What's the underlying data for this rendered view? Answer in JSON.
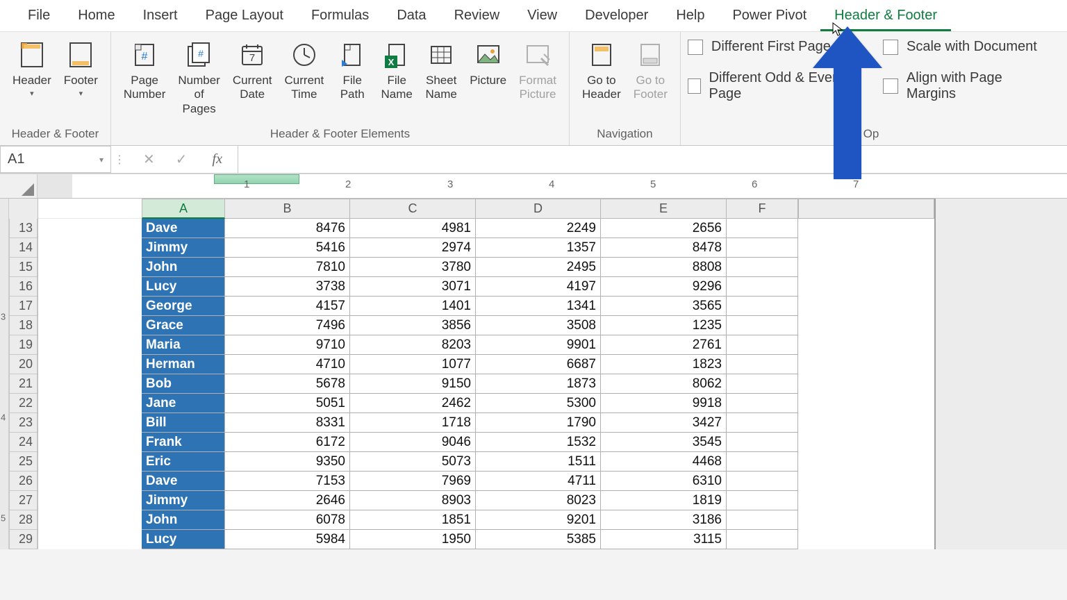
{
  "tabs": [
    "File",
    "Home",
    "Insert",
    "Page Layout",
    "Formulas",
    "Data",
    "Review",
    "View",
    "Developer",
    "Help",
    "Power Pivot",
    "Header & Footer"
  ],
  "activeTab": 11,
  "groups": {
    "hf": {
      "label": "Header & Footer",
      "header": "Header",
      "footer": "Footer"
    },
    "elements": {
      "label": "Header & Footer Elements",
      "items": [
        "Page\nNumber",
        "Number\nof Pages",
        "Current\nDate",
        "Current\nTime",
        "File\nPath",
        "File\nName",
        "Sheet\nName",
        "Picture",
        "Format\nPicture"
      ]
    },
    "nav": {
      "label": "Navigation",
      "goHeader": "Go to\nHeader",
      "goFooter": "Go to\nFooter"
    },
    "options": {
      "label": "Op",
      "firstPage": "Different First Page",
      "oddEven": "Different Odd & Even Page",
      "scale": "Scale with Document",
      "align": "Align with Page Margins"
    }
  },
  "nameBox": "A1",
  "fx": "fx",
  "rulerNums": [
    "1",
    "2",
    "3",
    "4",
    "5",
    "6",
    "7"
  ],
  "colHeaders": [
    "A",
    "B",
    "C",
    "D",
    "E",
    "F"
  ],
  "vNums": [
    "3",
    "4",
    "5"
  ],
  "rows": [
    {
      "n": "13",
      "name": "Dave",
      "v": [
        "8476",
        "4981",
        "2249",
        "2656"
      ]
    },
    {
      "n": "14",
      "name": "Jimmy",
      "v": [
        "5416",
        "2974",
        "1357",
        "8478"
      ]
    },
    {
      "n": "15",
      "name": "John",
      "v": [
        "7810",
        "3780",
        "2495",
        "8808"
      ]
    },
    {
      "n": "16",
      "name": "Lucy",
      "v": [
        "3738",
        "3071",
        "4197",
        "9296"
      ]
    },
    {
      "n": "17",
      "name": "George",
      "v": [
        "4157",
        "1401",
        "1341",
        "3565"
      ]
    },
    {
      "n": "18",
      "name": "Grace",
      "v": [
        "7496",
        "3856",
        "3508",
        "1235"
      ]
    },
    {
      "n": "19",
      "name": "Maria",
      "v": [
        "9710",
        "8203",
        "9901",
        "2761"
      ]
    },
    {
      "n": "20",
      "name": "Herman",
      "v": [
        "4710",
        "1077",
        "6687",
        "1823"
      ]
    },
    {
      "n": "21",
      "name": "Bob",
      "v": [
        "5678",
        "9150",
        "1873",
        "8062"
      ]
    },
    {
      "n": "22",
      "name": "Jane",
      "v": [
        "5051",
        "2462",
        "5300",
        "9918"
      ]
    },
    {
      "n": "23",
      "name": "Bill",
      "v": [
        "8331",
        "1718",
        "1790",
        "3427"
      ]
    },
    {
      "n": "24",
      "name": "Frank",
      "v": [
        "6172",
        "9046",
        "1532",
        "3545"
      ]
    },
    {
      "n": "25",
      "name": "Eric",
      "v": [
        "9350",
        "5073",
        "1511",
        "4468"
      ]
    },
    {
      "n": "26",
      "name": "Dave",
      "v": [
        "7153",
        "7969",
        "4711",
        "6310"
      ]
    },
    {
      "n": "27",
      "name": "Jimmy",
      "v": [
        "2646",
        "8903",
        "8023",
        "1819"
      ]
    },
    {
      "n": "28",
      "name": "John",
      "v": [
        "6078",
        "1851",
        "9201",
        "3186"
      ]
    },
    {
      "n": "29",
      "name": "Lucy",
      "v": [
        "5984",
        "1950",
        "5385",
        "3115"
      ]
    }
  ]
}
